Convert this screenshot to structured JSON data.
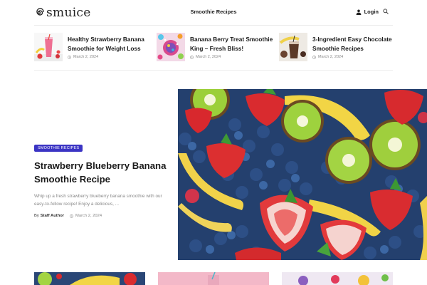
{
  "header": {
    "logo_text": "smuice",
    "nav_center": "Smoothie Recipes",
    "login_label": "Login"
  },
  "top_posts": [
    {
      "title": "Healthy Strawberry Banana Smoothie for Weight Loss",
      "date": "March 2, 2024"
    },
    {
      "title": "Banana Berry Treat Smoothie King – Fresh Bliss!",
      "date": "March 2, 2024"
    },
    {
      "title": "3-Ingredient Easy Chocolate Smoothie Recipes",
      "date": "March 2, 2024"
    }
  ],
  "hero": {
    "category": "SMOOTHIE RECIPES",
    "title": "Strawberry Blueberry Banana Smoothie Recipe",
    "excerpt": "Whip up a fresh strawberry blueberry banana smoothie with our easy-to-follow recipe! Enjoy a delicious, ...",
    "by": "By",
    "author": "Staff Author",
    "date": "March 2, 2024"
  },
  "colors": {
    "accent": "#3b34c4",
    "text": "#1b1b1b",
    "muted": "#8a8a8a"
  }
}
